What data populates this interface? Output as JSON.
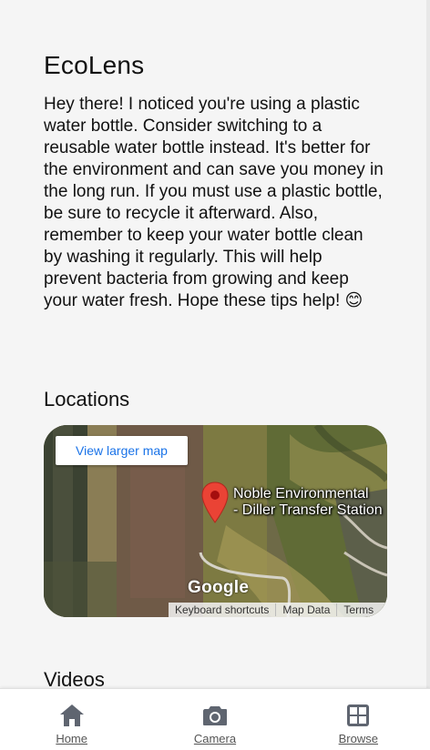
{
  "app": {
    "title": "EcoLens"
  },
  "tip": {
    "text": "Hey there! I noticed you're using a plastic water bottle. Consider switching to a reusable water bottle instead. It's better for the environment and can save you money in the long run. If you must use a plastic bottle, be sure to recycle it afterward. Also, remember to keep your water bottle clean by washing it regularly. This will help prevent bacteria from growing and keep your water fresh. Hope these tips help! 😊"
  },
  "locations": {
    "title": "Locations",
    "map": {
      "view_larger": "View larger map",
      "place_line1": "Noble Environmental",
      "place_line2": "- Diller Transfer Station",
      "logo": "Google",
      "attribution": [
        "Keyboard shortcuts",
        "Map Data",
        "Terms"
      ],
      "pin_color": "#ea4335"
    }
  },
  "videos": {
    "title": "Videos"
  },
  "nav": {
    "items": [
      {
        "label": "Home",
        "icon": "home-icon"
      },
      {
        "label": "Camera",
        "icon": "camera-icon"
      },
      {
        "label": "Browse",
        "icon": "browse-grid-icon"
      }
    ],
    "icon_color": "#5f6570"
  }
}
